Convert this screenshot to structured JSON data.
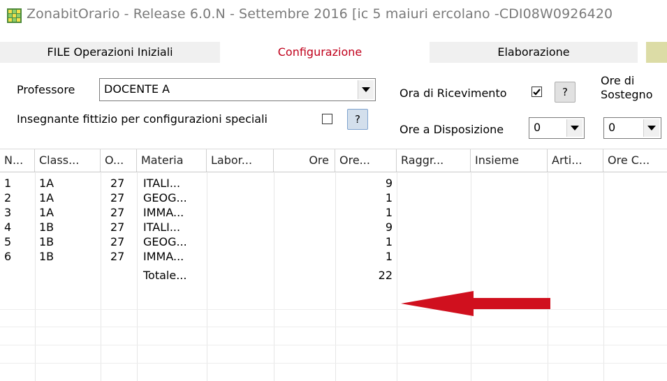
{
  "window": {
    "title": "ZonabitOrario - Release 6.0.N - Settembre 2016 [ic 5 maiuri ercolano -CDI08W0926420"
  },
  "tabs": [
    {
      "label": "FILE Operazioni Iniziali"
    },
    {
      "label": "Configurazione"
    },
    {
      "label": "Elaborazione"
    }
  ],
  "colors": {
    "active_tab_text": "#c0001b",
    "arrow": "#d0101e"
  },
  "form": {
    "professore_label": "Professore",
    "professore_value": "DOCENTE A",
    "fittizio_label": "Insegnante fittizio per configurazioni speciali",
    "fittizio_help": "?",
    "ricevimento_label": "Ora di Ricevimento",
    "ricevimento_checked": true,
    "ricevimento_help": "?",
    "disposizione_label": "Ore a Disposizione",
    "disposizione_value": "0",
    "sostegno_label_1": "Ore di",
    "sostegno_label_2": "Sostegno",
    "sostegno_value": "0"
  },
  "grid": {
    "columns": [
      "N...",
      "Class...",
      "O...",
      "Materia",
      "Labor...",
      "Ore",
      "Ore...",
      "Raggr...",
      "Insieme",
      "Arti...",
      "Ore C..."
    ],
    "rows": [
      {
        "n": "1",
        "classe": "1A",
        "o": "27",
        "materia": "ITALI...",
        "ore2": "9"
      },
      {
        "n": "2",
        "classe": "1A",
        "o": "27",
        "materia": "GEOG...",
        "ore2": "1"
      },
      {
        "n": "3",
        "classe": "1A",
        "o": "27",
        "materia": "IMMA...",
        "ore2": "1"
      },
      {
        "n": "4",
        "classe": "1B",
        "o": "27",
        "materia": "ITALI...",
        "ore2": "9"
      },
      {
        "n": "5",
        "classe": "1B",
        "o": "27",
        "materia": "GEOG...",
        "ore2": "1"
      },
      {
        "n": "6",
        "classe": "1B",
        "o": "27",
        "materia": "IMMA...",
        "ore2": "1"
      }
    ],
    "total_label": "Totale...",
    "total_value": "22"
  }
}
